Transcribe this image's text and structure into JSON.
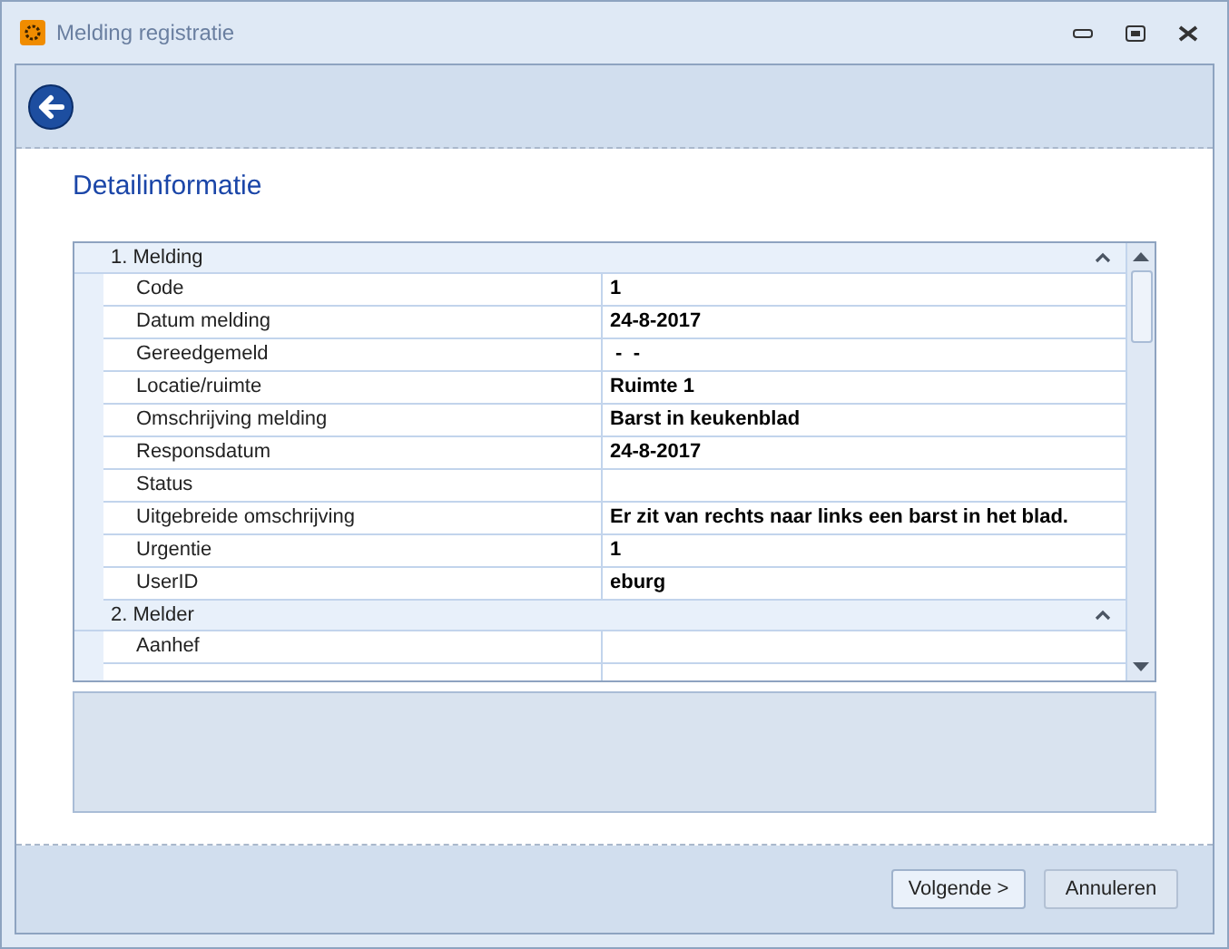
{
  "window": {
    "title": "Melding registratie"
  },
  "heading": "Detailinformatie",
  "groups": [
    {
      "title": "1. Melding",
      "expanded": true,
      "rows": [
        {
          "label": "Code",
          "value": "1"
        },
        {
          "label": "Datum melding",
          "value": "24-8-2017"
        },
        {
          "label": "Gereedgemeld",
          "value": " -  -"
        },
        {
          "label": "Locatie/ruimte",
          "value": "Ruimte 1"
        },
        {
          "label": "Omschrijving melding",
          "value": "Barst in keukenblad"
        },
        {
          "label": "Responsdatum",
          "value": "24-8-2017"
        },
        {
          "label": "Status",
          "value": ""
        },
        {
          "label": "Uitgebreide omschrijving",
          "value": "Er zit van rechts naar links een barst in het blad."
        },
        {
          "label": "Urgentie",
          "value": "1"
        },
        {
          "label": "UserID",
          "value": "eburg"
        }
      ]
    },
    {
      "title": "2. Melder",
      "expanded": true,
      "rows": [
        {
          "label": "Aanhef",
          "value": ""
        }
      ]
    }
  ],
  "buttons": [
    "Volgende >",
    "Annuleren"
  ]
}
